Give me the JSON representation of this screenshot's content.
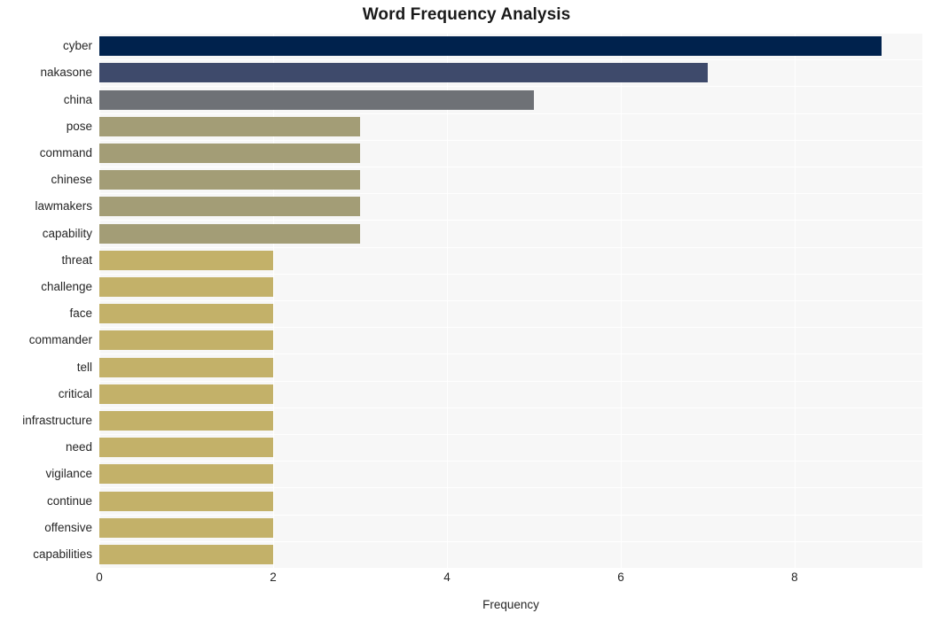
{
  "chart_data": {
    "type": "bar",
    "orientation": "horizontal",
    "title": "Word Frequency Analysis",
    "xlabel": "Frequency",
    "ylabel": "",
    "categories": [
      "cyber",
      "nakasone",
      "china",
      "pose",
      "command",
      "chinese",
      "lawmakers",
      "capability",
      "threat",
      "challenge",
      "face",
      "commander",
      "tell",
      "critical",
      "infrastructure",
      "need",
      "vigilance",
      "continue",
      "offensive",
      "capabilities"
    ],
    "values": [
      9,
      7,
      5,
      3,
      3,
      3,
      3,
      3,
      2,
      2,
      2,
      2,
      2,
      2,
      2,
      2,
      2,
      2,
      2,
      2
    ],
    "bar_colors": [
      "#00224d",
      "#3e4a6b",
      "#6e7176",
      "#a39d76",
      "#a39d76",
      "#a39d76",
      "#a39d76",
      "#a39d76",
      "#c3b169",
      "#c3b169",
      "#c3b169",
      "#c3b169",
      "#c3b169",
      "#c3b169",
      "#c3b169",
      "#c3b169",
      "#c3b169",
      "#c3b169",
      "#c3b169",
      "#c3b169"
    ],
    "xlim": [
      0,
      9.47
    ],
    "xticks": [
      0,
      2,
      4,
      6,
      8
    ],
    "xtick_labels": [
      "0",
      "2",
      "4",
      "6",
      "8"
    ],
    "grid": true,
    "grid_color": "#ffffff",
    "plot_background": "#f7f7f7",
    "figure_background": "#ffffff",
    "legend": "none"
  },
  "colors": {
    "title_text": "#1a1a1a",
    "axis_text": "#262626",
    "plot_bg": "#f7f7f7",
    "grid": "#ffffff",
    "figure_bg": "#ffffff"
  }
}
